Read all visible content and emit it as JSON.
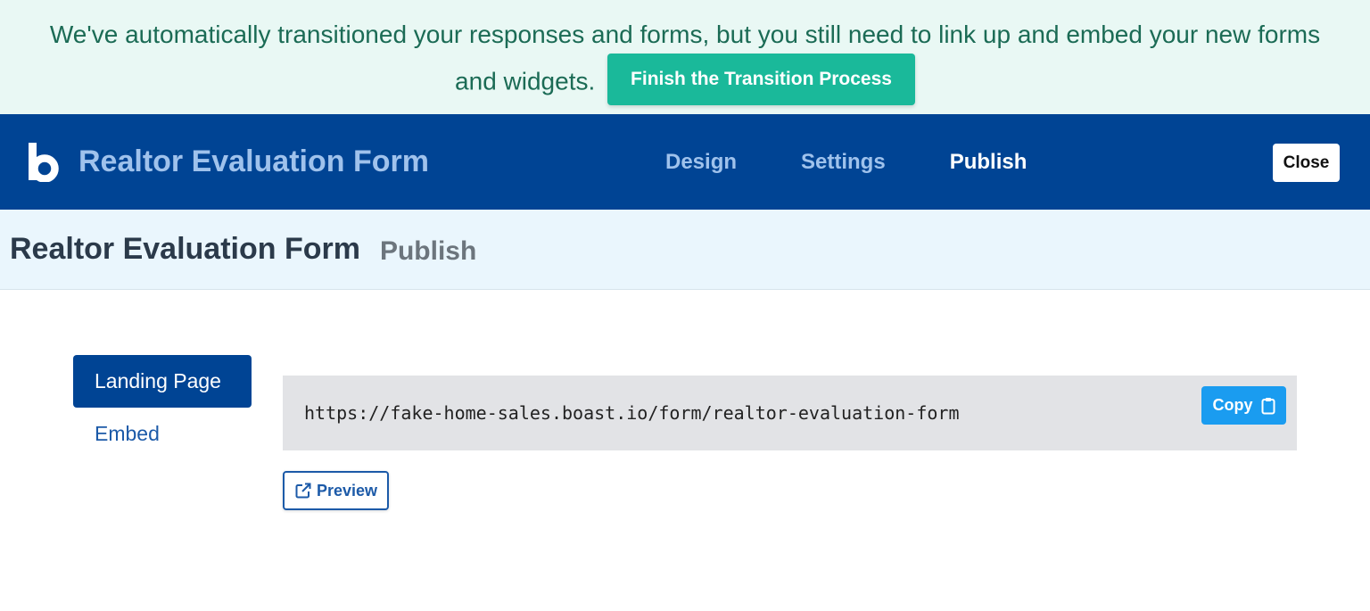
{
  "banner": {
    "message": "We've automatically transitioned your responses and forms, but you still need to link up and embed your new forms and widgets.",
    "action_label": "Finish the Transition Process"
  },
  "topbar": {
    "logo_icon": "boast-logo-icon",
    "app_title": "Realtor Evaluation Form",
    "nav": [
      {
        "label": "Design",
        "active": false
      },
      {
        "label": "Settings",
        "active": false
      },
      {
        "label": "Publish",
        "active": true
      }
    ],
    "close_label": "Close"
  },
  "subheader": {
    "title": "Realtor Evaluation Form",
    "subtitle": "Publish"
  },
  "sidebar": {
    "items": [
      {
        "label": "Landing Page",
        "active": true
      },
      {
        "label": "Embed",
        "active": false
      }
    ]
  },
  "publish": {
    "url": "https://fake-home-sales.boast.io/form/realtor-evaluation-form",
    "copy_label": "Copy",
    "copy_icon": "clipboard-icon",
    "preview_label": "Preview",
    "preview_icon": "external-link-icon"
  },
  "colors": {
    "brand": "#004494",
    "banner_bg": "#e9f8f4",
    "banner_button": "#1ab99a",
    "copy_button": "#1a9cf0"
  }
}
